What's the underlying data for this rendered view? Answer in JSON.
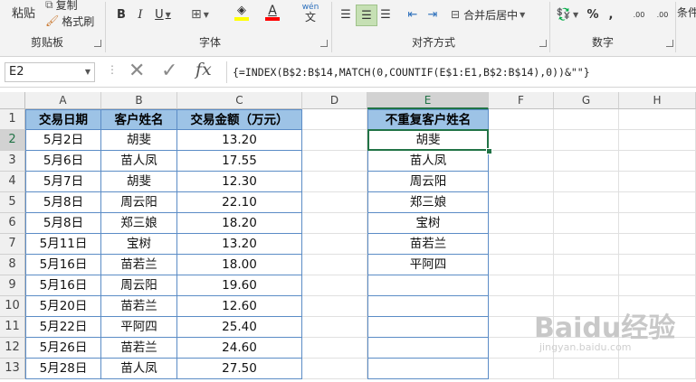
{
  "ribbon": {
    "clipboard": {
      "paste": "粘贴",
      "copy": "复制",
      "format_painter": "格式刷",
      "group_label": "剪贴板"
    },
    "font": {
      "bold": "B",
      "italic": "I",
      "underline": "U",
      "font_color_glyph": "A",
      "wen": "wén",
      "wen_sub": "文",
      "group_label": "字体"
    },
    "alignment": {
      "merge_center": "合并后居中",
      "group_label": "对齐方式"
    },
    "number": {
      "percent": "%",
      "comma": ",",
      "dec_inc": ".00",
      "dec_dec": ".00",
      "group_label": "数字"
    },
    "conditional": "条件"
  },
  "formula_bar": {
    "name_box": "E2",
    "fx": "fx",
    "formula": "{=INDEX(B$2:B$14,MATCH(0,COUNTIF(E$1:E1,B$2:B$14),0))&\"\"}"
  },
  "columns": [
    "A",
    "B",
    "C",
    "D",
    "E",
    "F",
    "G",
    "H"
  ],
  "rows": [
    "1",
    "2",
    "3",
    "4",
    "5",
    "6",
    "7",
    "8",
    "9",
    "10",
    "11",
    "12",
    "13"
  ],
  "table": {
    "headers": [
      "交易日期",
      "客户姓名",
      "交易金额（万元）"
    ],
    "rows": [
      [
        "5月2日",
        "胡斐",
        "13.20"
      ],
      [
        "5月6日",
        "苗人凤",
        "17.55"
      ],
      [
        "5月7日",
        "胡斐",
        "12.30"
      ],
      [
        "5月8日",
        "周云阳",
        "22.10"
      ],
      [
        "5月8日",
        "郑三娘",
        "18.20"
      ],
      [
        "5月11日",
        "宝树",
        "13.20"
      ],
      [
        "5月16日",
        "苗若兰",
        "18.00"
      ],
      [
        "5月16日",
        "周云阳",
        "19.60"
      ],
      [
        "5月20日",
        "苗若兰",
        "12.60"
      ],
      [
        "5月22日",
        "平阿四",
        "25.40"
      ],
      [
        "5月26日",
        "苗若兰",
        "24.60"
      ],
      [
        "5月28日",
        "苗人凤",
        "27.50"
      ]
    ]
  },
  "unique": {
    "header": "不重复客户姓名",
    "values": [
      "胡斐",
      "苗人凤",
      "周云阳",
      "郑三娘",
      "宝树",
      "苗若兰",
      "平阿四",
      "",
      "",
      "",
      "",
      ""
    ]
  },
  "watermark": {
    "text": "Baidu经验",
    "sub": "jingyan.baidu.com"
  },
  "colors": {
    "header_fill": "#9dc3e6",
    "table_border": "#5b8cc6",
    "selection": "#217346",
    "highlight_fill": "#ffff00",
    "font_red": "#ff0000"
  }
}
